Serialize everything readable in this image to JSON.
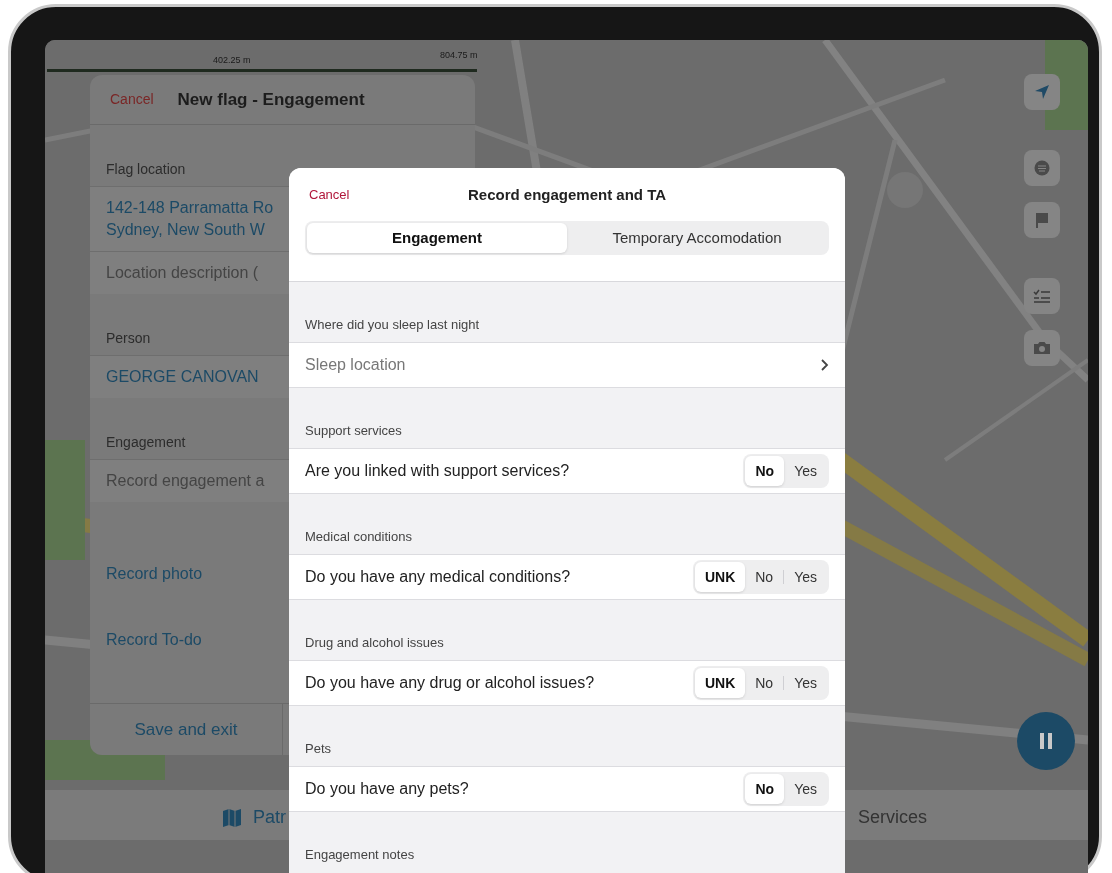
{
  "scale_bar": {
    "labels": [
      "402.25 m",
      "804.75 m"
    ]
  },
  "flag_panel": {
    "cancel": "Cancel",
    "title": "New flag - Engagement",
    "sections": [
      {
        "label": "Flag location",
        "rows": [
          {
            "kind": "value",
            "lines": [
              "142-148 Parramatta Ro",
              "Sydney, New South W"
            ]
          },
          {
            "kind": "placeholder",
            "lines": [
              "Location description ("
            ]
          }
        ]
      },
      {
        "label": "Person",
        "rows": [
          {
            "kind": "value",
            "lines": [
              "GEORGE CANOVAN"
            ]
          }
        ]
      },
      {
        "label": "Engagement",
        "rows": [
          {
            "kind": "placeholder",
            "lines": [
              "Record engagement a"
            ]
          }
        ]
      }
    ],
    "actions": [
      "Record photo",
      "Record To-do"
    ],
    "footer_button": "Save and exit"
  },
  "tab_bar": [
    {
      "label": "Patr",
      "has_icon": true
    },
    {
      "label": "Services",
      "has_icon": false
    }
  ],
  "engagement_sheet": {
    "cancel": "Cancel",
    "title": "Record engagement and TA",
    "tabs": [
      {
        "label": "Engagement",
        "selected": true
      },
      {
        "label": "Temporary Accomodation",
        "selected": false
      }
    ],
    "sections": [
      {
        "header": "Where did you sleep last night",
        "row": {
          "kind": "picker",
          "label": "Sleep location"
        }
      },
      {
        "header": "Support services",
        "row": {
          "kind": "segmented",
          "question": "Are you linked with support services?",
          "options": [
            {
              "label": "No",
              "selected": true
            },
            {
              "label": "Yes",
              "selected": false
            }
          ]
        }
      },
      {
        "header": "Medical conditions",
        "row": {
          "kind": "segmented",
          "question": "Do you have any medical conditions?",
          "options": [
            {
              "label": "UNK",
              "selected": true
            },
            {
              "label": "No",
              "selected": false
            },
            {
              "label": "Yes",
              "selected": false
            }
          ]
        }
      },
      {
        "header": "Drug and alcohol issues",
        "row": {
          "kind": "segmented",
          "question": "Do you have any drug or alcohol issues?",
          "options": [
            {
              "label": "UNK",
              "selected": true
            },
            {
              "label": "No",
              "selected": false
            },
            {
              "label": "Yes",
              "selected": false
            }
          ]
        }
      },
      {
        "header": "Pets",
        "row": {
          "kind": "segmented",
          "question": "Do you have any pets?",
          "options": [
            {
              "label": "No",
              "selected": true
            },
            {
              "label": "Yes",
              "selected": false
            }
          ]
        }
      },
      {
        "header": "Engagement notes"
      }
    ]
  }
}
